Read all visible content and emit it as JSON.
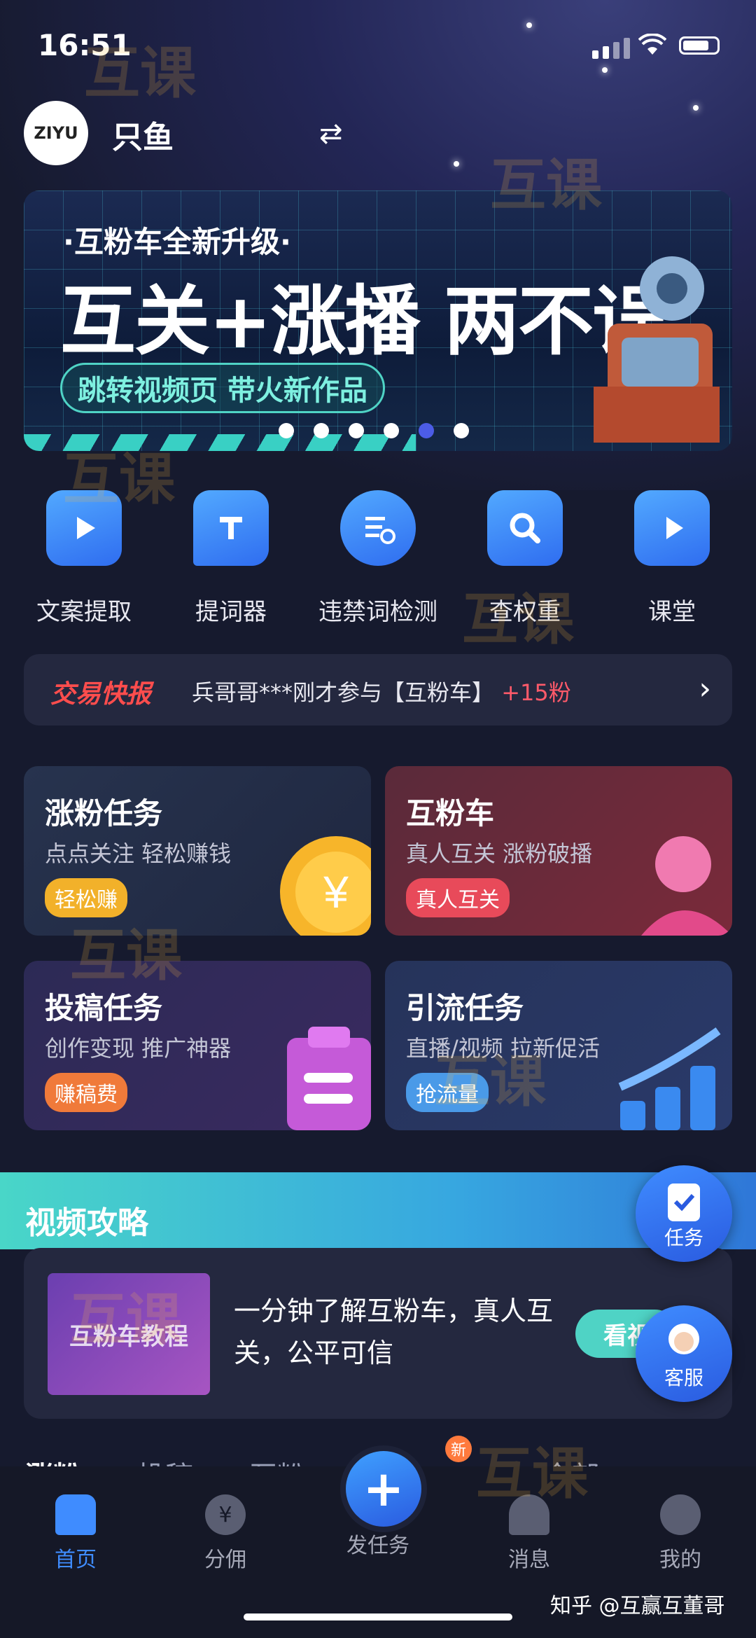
{
  "status_bar": {
    "time": "16:51"
  },
  "header": {
    "avatar_text": "ZIYU",
    "user_name": "只鱼",
    "switch_icon": "⇄"
  },
  "banner": {
    "subtitle": "·互粉车全新升级·",
    "title": "互关+涨播 两不误",
    "tag": "跳转视频页 带火新作品",
    "dots_total": 6,
    "dots_active_index": 4
  },
  "tools": [
    {
      "label": "文案提取",
      "icon": "play-icon"
    },
    {
      "label": "提词器",
      "icon": "text-bubble-icon"
    },
    {
      "label": "违禁词检测",
      "icon": "word-check-icon"
    },
    {
      "label": "查权重",
      "icon": "search-icon"
    },
    {
      "label": "课堂",
      "icon": "video-class-icon"
    }
  ],
  "news": {
    "badge": "交易快报",
    "text": "兵哥哥***刚才参与【互粉车】",
    "plus": "+15粉"
  },
  "cards": [
    {
      "title": "涨粉任务",
      "subtitle": "点点关注 轻松赚钱",
      "tag": "轻松赚"
    },
    {
      "title": "互粉车",
      "subtitle": "真人互关 涨粉破播",
      "tag": "真人互关"
    },
    {
      "title": "投稿任务",
      "subtitle": "创作变现 推广神器",
      "tag": "赚稿费"
    },
    {
      "title": "引流任务",
      "subtitle": "直播/视频 拉新促活",
      "tag": "抢流量"
    }
  ],
  "video_section": {
    "title": "视频攻略",
    "thumb_text": "互粉车教程",
    "text": "一分钟了解互粉车，真人互关，公平可信",
    "watch_button": "看视"
  },
  "fabs": {
    "task": "任务",
    "service": "客服"
  },
  "tabs": [
    "涨粉",
    "投稿",
    "互粉",
    "文",
    "全部 ›"
  ],
  "new_badge": "新",
  "bottom_nav": [
    "首页",
    "分佣",
    "发任务",
    "消息",
    "我的"
  ],
  "footer_text": "知乎 @互赢互董哥",
  "watermark": "互课"
}
